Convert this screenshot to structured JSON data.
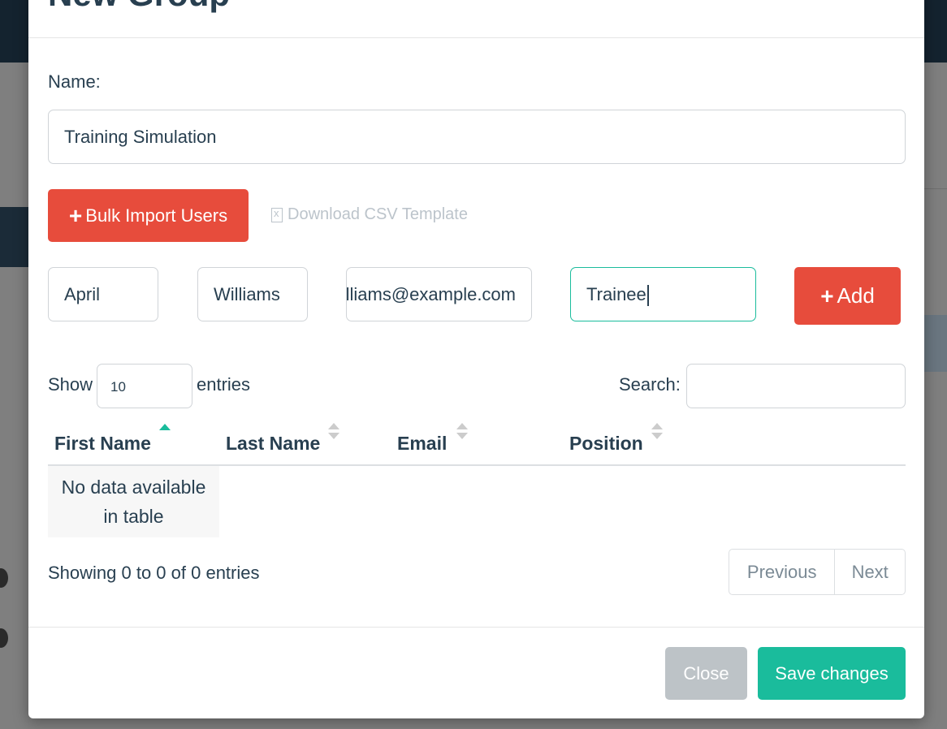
{
  "modal": {
    "title": "New Group",
    "name_label": "Name:",
    "name_value": "Training Simulation"
  },
  "actions": {
    "bulk_import_label": "Bulk Import Users",
    "download_csv_label": "Download CSV Template"
  },
  "new_user": {
    "first_name": "April",
    "last_name": "Williams",
    "email": "april.williams@example.com",
    "position": "Trainee",
    "add_label": "Add"
  },
  "table_controls": {
    "show_label": "Show",
    "entries_value": "10",
    "entries_label": "entries",
    "search_label": "Search:",
    "search_value": ""
  },
  "table": {
    "columns": [
      "First Name",
      "Last Name",
      "Email",
      "Position"
    ],
    "sorted_column": "First Name",
    "sort_direction": "ascending",
    "empty_message_line1": "No data available",
    "empty_message_line2": "in table",
    "info": "Showing 0 to 0 of 0 entries"
  },
  "pagination": {
    "previous_label": "Previous",
    "next_label": "Next"
  },
  "footer": {
    "close_label": "Close",
    "save_label": "Save changes"
  },
  "colors": {
    "primary_text": "#283f50",
    "danger": "#e74c3c",
    "success": "#1abc9c",
    "disabled": "#bdc3c7"
  }
}
